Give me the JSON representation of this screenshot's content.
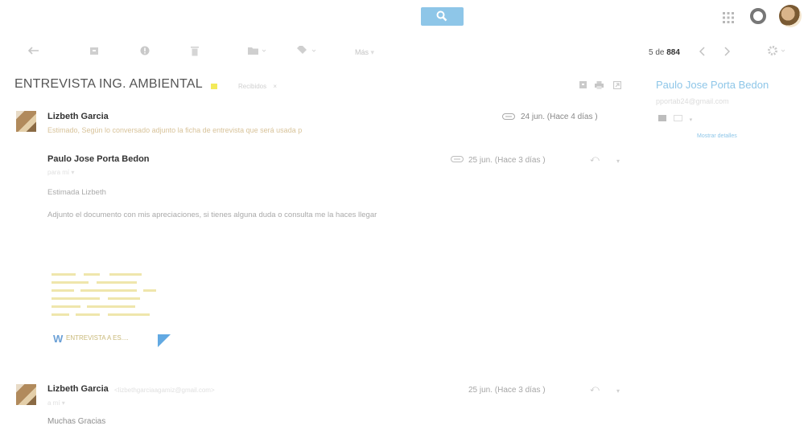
{
  "toolbar": {
    "more_label": "Más",
    "count_current": "5 de",
    "count_total": "884"
  },
  "thread": {
    "subject": "ENTREVISTA ING. AMBIENTAL",
    "label": "Recibidos",
    "label_color": "#f3ea5a"
  },
  "contact": {
    "name": "Paulo Jose Porta Bedon",
    "email": "pportab24@gmail.com",
    "more_details": "Mostrar detalles"
  },
  "messages": [
    {
      "sender": "Lizbeth Garcia",
      "snippet": "Estimado, Según lo conversado adjunto la ficha de entrevista que será usada p",
      "date": "24 jun. (Hace 4 días )"
    },
    {
      "sender": "Paulo Jose Porta Bedon",
      "to": "para mí",
      "date": "25 jun. (Hace 3 días )",
      "greeting": "Estimada Lizbeth",
      "body": "Adjunto el documento con mis apreciaciones, si tienes alguna duda o consulta me la haces llegar",
      "attachment_name": "ENTREVISTA A ES...."
    },
    {
      "sender": "Lizbeth Garcia",
      "sender_email": "<lizbethgarciaagamiz@gmail.com>",
      "to": "a mí",
      "date": "25 jun. (Hace 3 días )",
      "body": "Muchas Gracias"
    }
  ],
  "colors": {
    "accent": "#8ec6e8",
    "attachment": "#62a9e2"
  }
}
